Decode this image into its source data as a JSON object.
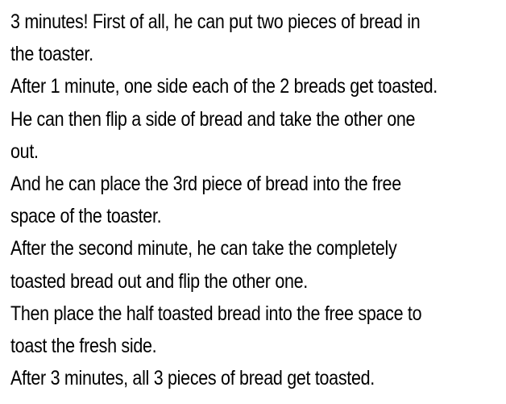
{
  "document": {
    "lines": [
      "3 minutes! First of all, he can put two pieces of bread in",
      "the toaster.",
      "After 1 minute, one side each of the 2 breads get toasted.",
      "He can then flip a side of bread and take the other one",
      "out.",
      "And he can place the 3rd piece of bread into the free",
      "space of the toaster.",
      "After the second minute, he can take the completely",
      "toasted bread out and flip the other one.",
      "Then place the half toasted bread into the free space to",
      "toast the fresh side.",
      "After 3 minutes, all 3 pieces of bread get toasted."
    ]
  }
}
